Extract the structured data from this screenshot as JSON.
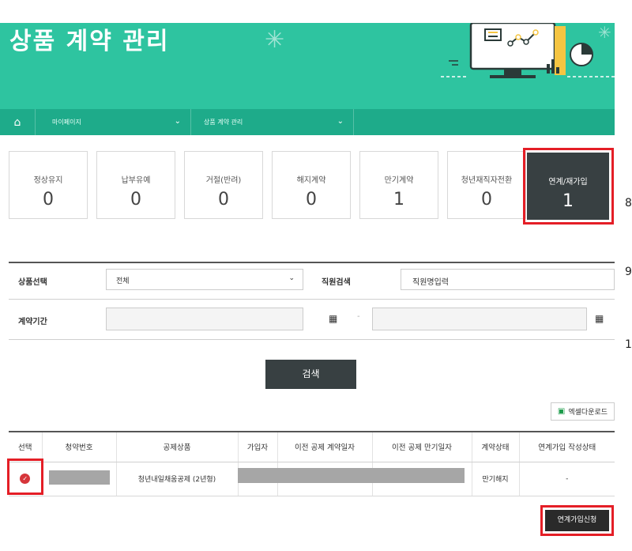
{
  "banner": {
    "title": "상품 계약 관리",
    "nav": {
      "home_icon": "home-icon",
      "mypage_label": "마이페이지",
      "contract_label": "상품 계약 관리"
    }
  },
  "summary": {
    "cards": [
      {
        "label": "정상유지",
        "value": "0"
      },
      {
        "label": "납부유예",
        "value": "0"
      },
      {
        "label": "거절(반려)",
        "value": "0"
      },
      {
        "label": "해지계약",
        "value": "0"
      },
      {
        "label": "만기계약",
        "value": "1"
      },
      {
        "label": "청년재직자전환",
        "value": "0"
      },
      {
        "label": "연계/재가입",
        "value": "1"
      }
    ]
  },
  "side_digits": [
    "8",
    "9",
    "1"
  ],
  "search": {
    "product_label": "상품선택",
    "product_value": "전체",
    "employee_label": "직원검색",
    "employee_placeholder": "직원명입력",
    "period_label": "계약기간",
    "period_separator": "-",
    "search_button": "검색"
  },
  "excel_button": "엑셀다운로드",
  "table": {
    "headers": [
      "선택",
      "청약번호",
      "공제상품",
      "가입자",
      "이전 공제 계약일자",
      "이전 공제 만기일자",
      "계약상태",
      "연계가입 작성상태"
    ],
    "rows": [
      {
        "product": "청년내일채움공제 (2년형)",
        "status": "만기해지",
        "link_status": "-"
      }
    ]
  },
  "apply_button": "연계가입신청",
  "colors": {
    "accent": "#2ec4a0",
    "dark": "#384042",
    "highlight": "#e41e26"
  }
}
